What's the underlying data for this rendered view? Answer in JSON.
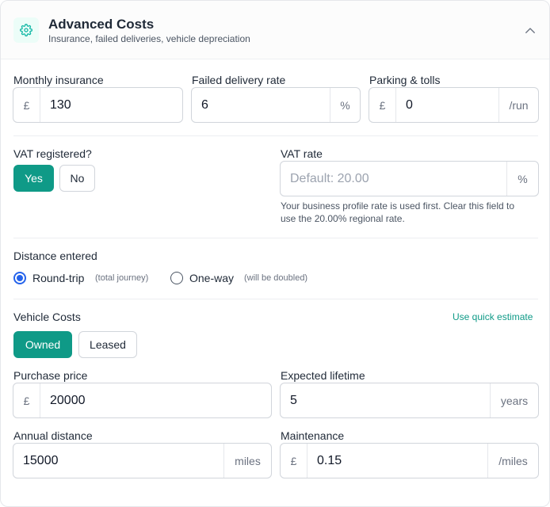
{
  "header": {
    "title": "Advanced Costs",
    "subtitle": "Insurance, failed deliveries, vehicle depreciation"
  },
  "monthly_insurance": {
    "label": "Monthly insurance",
    "prefix": "£",
    "value": "130"
  },
  "failed_delivery": {
    "label": "Failed delivery rate",
    "value": "6",
    "suffix": "%"
  },
  "parking": {
    "label": "Parking & tolls",
    "prefix": "£",
    "value": "0",
    "suffix": "/run"
  },
  "vat": {
    "label": "VAT registered?",
    "yes": "Yes",
    "no": "No",
    "selected": "Yes"
  },
  "vat_rate": {
    "label": "VAT rate",
    "placeholder": "Default: 20.00",
    "suffix": "%",
    "help_line1": "Your business profile rate is used first. Clear this field to",
    "help_line2": "use the 20.00% regional rate."
  },
  "distance": {
    "label": "Distance entered",
    "option1": "Round-trip",
    "option1_note": "(total journey)",
    "option2": "One-way",
    "option2_note": "(will be doubled)",
    "selected": "Round-trip"
  },
  "vehicle": {
    "label": "Vehicle Costs",
    "quick_estimate": "Use quick estimate",
    "owned": "Owned",
    "leased": "Leased",
    "selected": "Owned"
  },
  "purchase_price": {
    "label": "Purchase price",
    "prefix": "£",
    "value": "20000"
  },
  "lifetime": {
    "label": "Expected lifetime",
    "value": "5",
    "suffix": "years"
  },
  "annual_distance": {
    "label": "Annual distance",
    "value": "15000",
    "suffix": "miles"
  },
  "maintenance": {
    "label": "Maintenance",
    "prefix": "£",
    "value": "0.15",
    "suffix": "/miles"
  },
  "colors": {
    "accent": "#0f9a87",
    "radio": "#2563eb"
  }
}
